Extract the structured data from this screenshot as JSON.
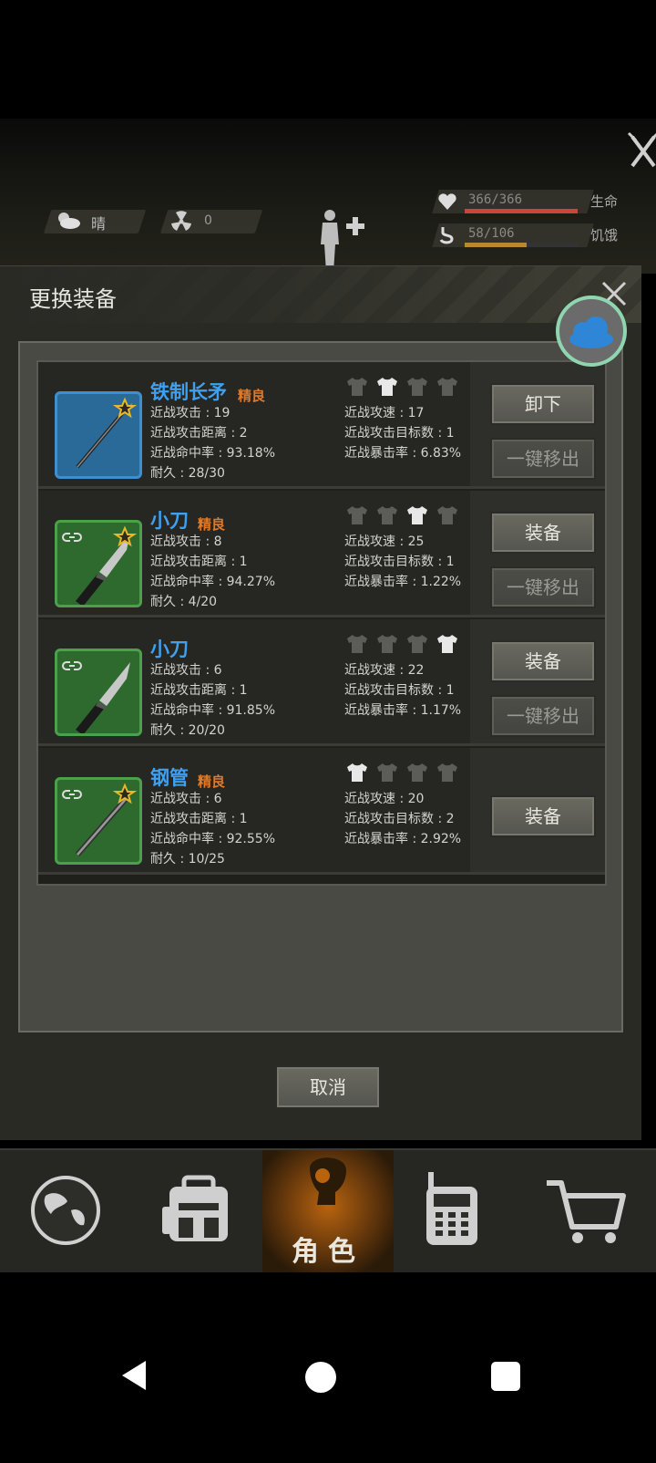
{
  "hud": {
    "weather_label": "晴",
    "radiation_value": "0",
    "health": {
      "text": "366/366",
      "label": "生命",
      "fraction": 1.0,
      "color": "#c8463a"
    },
    "hunger": {
      "text": "58/106",
      "label": "饥饿",
      "fraction": 0.547,
      "color": "#b8892a"
    }
  },
  "dialog": {
    "title": "更换装备",
    "cancel_label": "取消"
  },
  "labels": {
    "unequip": "卸下",
    "equip": "装备",
    "remove_all": "一键移出"
  },
  "items": [
    {
      "name": "铁制长矛",
      "quality": "精良",
      "frame": "blue",
      "weapon": "spear",
      "linked": false,
      "starred": true,
      "active_slot": 1,
      "stats": {
        "atk": "近战攻击 : 19",
        "range": "近战攻击距离 : 2",
        "hit": "近战命中率 : 93.18%",
        "dur": "耐久 : 28/30",
        "speed": "近战攻速 : 17",
        "targets": "近战攻击目标数 : 1",
        "crit": "近战暴击率 : 6.83%"
      }
    },
    {
      "name": "小刀",
      "quality": "精良",
      "frame": "green",
      "weapon": "knife",
      "linked": true,
      "starred": true,
      "active_slot": 2,
      "stats": {
        "atk": "近战攻击 : 8",
        "range": "近战攻击距离 : 1",
        "hit": "近战命中率 : 94.27%",
        "dur": "耐久 : 4/20",
        "speed": "近战攻速 : 25",
        "targets": "近战攻击目标数 : 1",
        "crit": "近战暴击率 : 1.22%"
      }
    },
    {
      "name": "小刀",
      "quality": "",
      "frame": "green",
      "weapon": "knife",
      "linked": true,
      "starred": false,
      "active_slot": 3,
      "stats": {
        "atk": "近战攻击 : 6",
        "range": "近战攻击距离 : 1",
        "hit": "近战命中率 : 91.85%",
        "dur": "耐久 : 20/20",
        "speed": "近战攻速 : 22",
        "targets": "近战攻击目标数 : 1",
        "crit": "近战暴击率 : 1.17%"
      }
    },
    {
      "name": "钢管",
      "quality": "精良",
      "frame": "green",
      "weapon": "pipe",
      "linked": true,
      "starred": true,
      "active_slot": 0,
      "stats": {
        "atk": "近战攻击 : 6",
        "range": "近战攻击距离 : 1",
        "hit": "近战命中率 : 92.55%",
        "dur": "耐久 : 10/25",
        "speed": "近战攻速 : 20",
        "targets": "近战攻击目标数 : 2",
        "crit": "近战暴击率 : 2.92%"
      }
    }
  ],
  "tabs": [
    {
      "icon": "globe-icon",
      "label": ""
    },
    {
      "icon": "backpack-icon",
      "label": ""
    },
    {
      "icon": "character-icon",
      "label": "角色",
      "active": true
    },
    {
      "icon": "radio-icon",
      "label": ""
    },
    {
      "icon": "cart-icon",
      "label": ""
    }
  ],
  "colors": {
    "item_name": "#3fa0ef",
    "quality": "#e07a28",
    "cloud_ring": "#8fd6b0",
    "tab_active": "#b8640f"
  }
}
